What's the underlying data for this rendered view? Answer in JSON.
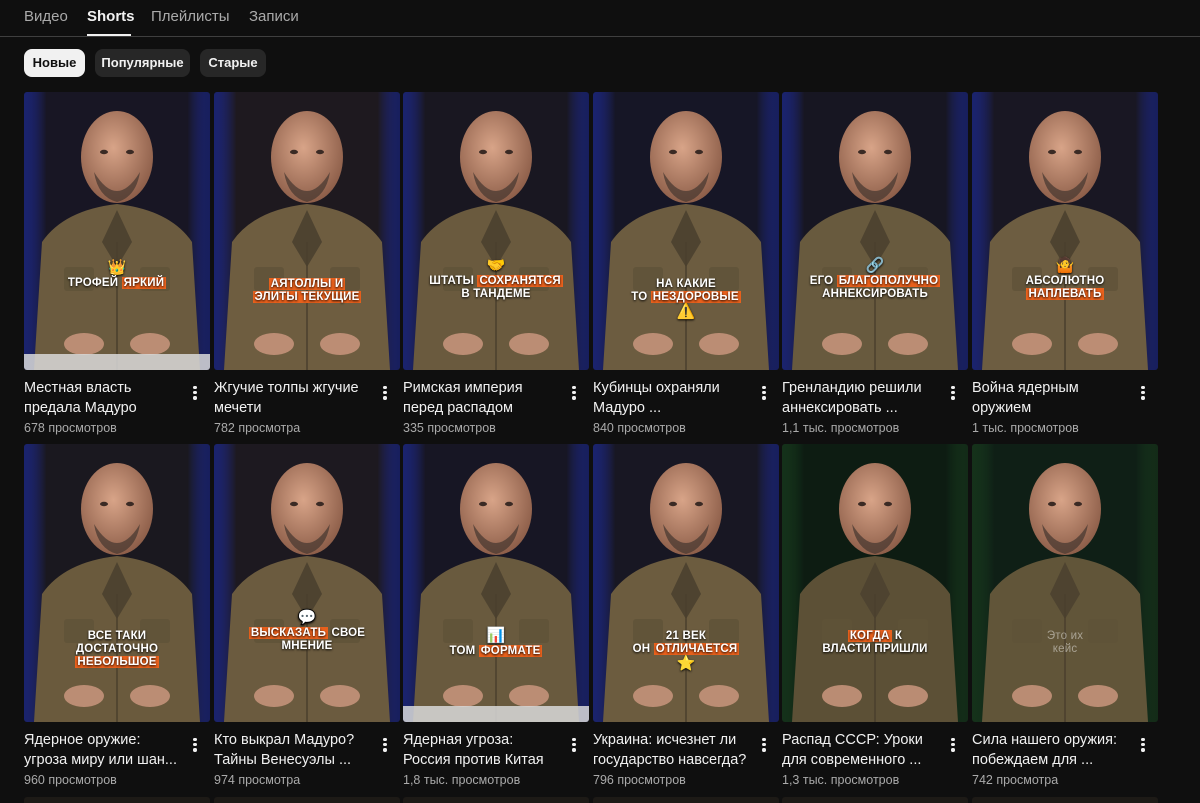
{
  "tabs": [
    {
      "label": "Видео",
      "active": false
    },
    {
      "label": "Shorts",
      "active": true
    },
    {
      "label": "Плейлисты",
      "active": false
    },
    {
      "label": "Записи",
      "active": false
    }
  ],
  "filters": [
    {
      "label": "Новые",
      "active": true
    },
    {
      "label": "Популярные",
      "active": false
    },
    {
      "label": "Старые",
      "active": false
    }
  ],
  "colors": {
    "background": "#0f0f0f",
    "chip": "#272727",
    "chip_active": "#f1f1f1",
    "caption_highlight": "#e8601c",
    "secondary_text": "#aaaaaa"
  },
  "shorts": [
    {
      "title": "Местная власть предала Мадуро",
      "views": "678 просмотров",
      "caption": {
        "emoji": "👑",
        "line1_pre": "ТРОФЕЙ ",
        "line1_hl": "ЯРКИЙ",
        "line1_post": "",
        "line2_pre": "",
        "line2_hl": "",
        "line2_post": ""
      }
    },
    {
      "title": "Жгучие толпы жгучие мечети",
      "views": "782 просмотра",
      "caption": {
        "emoji": "",
        "line1_pre": "",
        "line1_hl": "АЯТОЛЛЫ И",
        "line1_post": "",
        "line2_pre": "",
        "line2_hl": "ЭЛИТЫ ТЕКУЩИЕ",
        "line2_post": ""
      }
    },
    {
      "title": "Римская империя перед распадом",
      "views": "335 просмотров",
      "caption": {
        "emoji": "🤝",
        "line1_pre": "ШТАТЫ ",
        "line1_hl": "СОХРАНЯТСЯ",
        "line1_post": "",
        "line2_pre": "В ТАНДЕМЕ",
        "line2_hl": "",
        "line2_post": ""
      }
    },
    {
      "title": "Кубинцы охраняли Мадуро ...",
      "views": "840 просмотров",
      "caption": {
        "emoji": "",
        "line1_pre": "НА КАКИЕ",
        "line1_hl": "",
        "line1_post": "",
        "line2_pre": "ТО ",
        "line2_hl": "НЕЗДОРОВЫЕ",
        "line2_post": "",
        "emoji_after": "⚠️"
      }
    },
    {
      "title": "Гренландию решили аннексировать ...",
      "views": "1,1 тыс. просмотров",
      "caption": {
        "emoji": "🔗",
        "line1_pre": "ЕГО ",
        "line1_hl": "БЛАГОПОЛУЧНО",
        "line1_post": "",
        "line2_pre": "АННЕКСИРОВАТЬ",
        "line2_hl": "",
        "line2_post": ""
      }
    },
    {
      "title": "Война ядерным оружием",
      "views": "1 тыс. просмотров",
      "caption": {
        "emoji": "🤷",
        "line1_pre": "АБСОЛЮТНО",
        "line1_hl": "",
        "line1_post": "",
        "line2_pre": "",
        "line2_hl": "НАПЛЕВАТЬ",
        "line2_post": ""
      }
    },
    {
      "title": "Ядерное оружие: угроза миру или шан...",
      "views": "960 просмотров",
      "caption": {
        "emoji": "",
        "line1_pre": "ВСЕ ТАКИ",
        "line1_hl": "",
        "line1_post": "",
        "line2_pre": "ДОСТАТОЧНО",
        "line2_hl": "",
        "line2_post": "",
        "line3_hl": "НЕБОЛЬШОЕ"
      }
    },
    {
      "title": "Кто выкрал Мадуро? Тайны Венесуэлы ...",
      "views": "974 просмотра",
      "caption": {
        "emoji": "💬",
        "line1_pre": "",
        "line1_hl": "ВЫСКАЗАТЬ",
        "line1_post": " СВОЕ",
        "line2_pre": "МНЕНИЕ",
        "line2_hl": "",
        "line2_post": ""
      }
    },
    {
      "title": "Ядерная угроза: Россия против Китая",
      "views": "1,8 тыс. просмотров",
      "caption": {
        "emoji": "📊",
        "line1_pre": "ТОМ ",
        "line1_hl": "ФОРМАТЕ",
        "line1_post": "",
        "line2_pre": "",
        "line2_hl": "",
        "line2_post": ""
      }
    },
    {
      "title": "Украина: исчезнет ли государство навсегда?",
      "views": "796 просмотров",
      "caption": {
        "emoji": "",
        "line1_pre": "21 ВЕК",
        "line1_hl": "",
        "line1_post": "",
        "line2_pre": "ОН ",
        "line2_hl": "ОТЛИЧАЕТСЯ",
        "line2_post": "",
        "emoji_after": "⭐"
      }
    },
    {
      "title": "Распад СССР: Уроки для современного ...",
      "views": "1,3 тыс. просмотров",
      "caption": {
        "emoji": "",
        "line1_pre": "",
        "line1_hl": "КОГДА",
        "line1_post": " К",
        "line2_pre": "ВЛАСТИ ПРИШЛИ",
        "line2_hl": "",
        "line2_post": ""
      }
    },
    {
      "title": "Сила нашего оружия: побеждаем для ...",
      "views": "742 просмотра",
      "caption": {
        "emoji": "",
        "line1_pre": "Это их",
        "line1_hl": "",
        "line1_post": "",
        "line2_pre": "кейс",
        "line2_hl": "",
        "line2_post": "",
        "faint": true
      }
    }
  ]
}
